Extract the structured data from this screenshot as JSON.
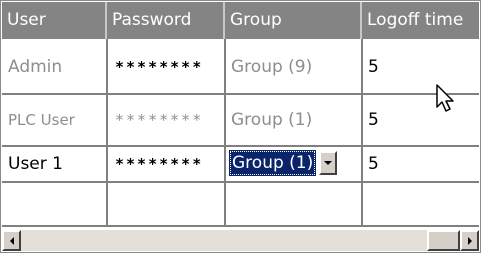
{
  "table": {
    "headers": {
      "user": "User",
      "password": "Password",
      "group": "Group",
      "logoff": "Logoff time"
    },
    "rows": [
      {
        "user": "Admin",
        "password": "********",
        "group": "Group (9)",
        "logoff": "5"
      },
      {
        "user": "PLC User",
        "password": "********",
        "group": "Group (1)",
        "logoff": "5"
      },
      {
        "user": "User 1",
        "password": "********",
        "group": "Group (1)",
        "logoff": "5"
      },
      {
        "user": "",
        "password": "",
        "group": "",
        "logoff": ""
      }
    ]
  },
  "colors": {
    "header_bg": "#848484",
    "selection_bg": "#0a246a",
    "grid_line": "#808080",
    "disabled_text": "#8e8e8e"
  },
  "icons": {
    "cursor": "mouse-pointer-icon",
    "dropdown": "chevron-down-icon",
    "scroll_left": "scroll-left-arrow-icon",
    "scroll_right": "scroll-right-arrow-icon"
  }
}
